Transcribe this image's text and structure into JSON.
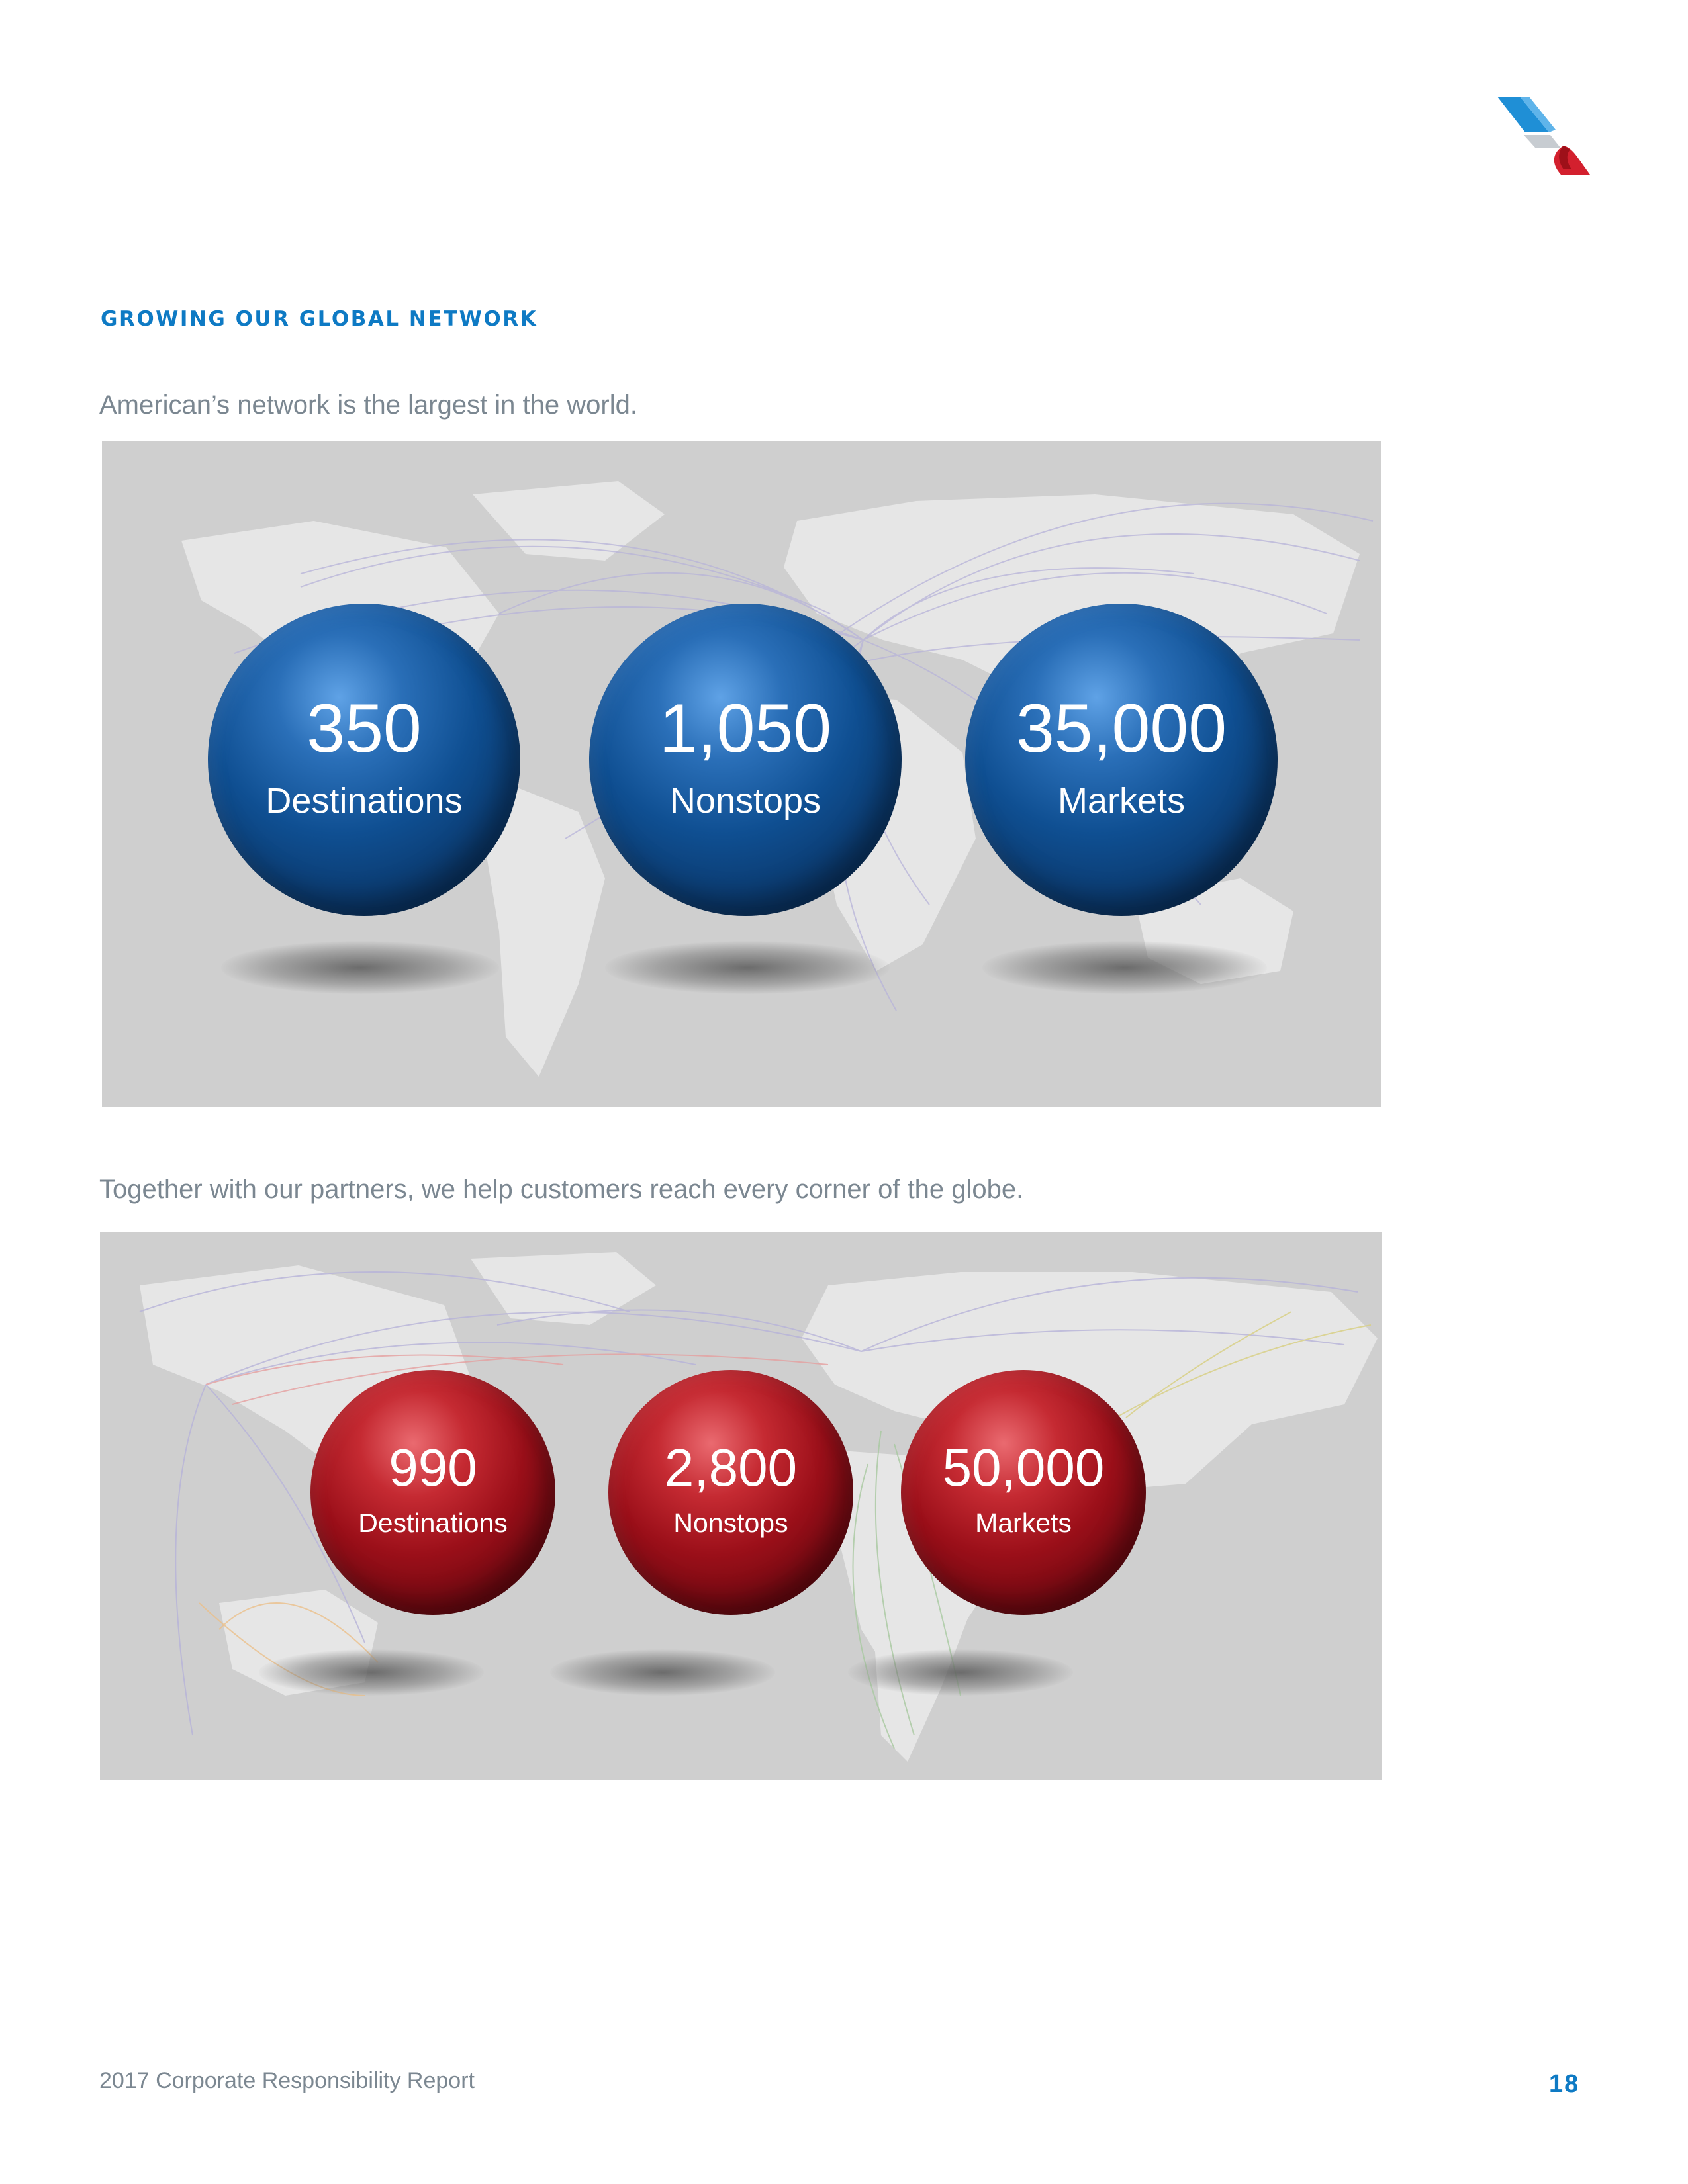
{
  "brand": {
    "logo_icon": "american-airlines-flight-symbol-icon",
    "colors": {
      "blue": "#0e7ac4",
      "red": "#c52a32",
      "silver": "#c7ccd1"
    }
  },
  "section": {
    "title": "GROWING OUR GLOBAL NETWORK"
  },
  "american_network": {
    "lead": "American’s network is the largest in the world.",
    "stats": [
      {
        "value": "350",
        "label": "Destinations"
      },
      {
        "value": "1,050",
        "label": "Nonstops"
      },
      {
        "value": "35,000",
        "label": "Markets"
      }
    ]
  },
  "partner_network": {
    "lead": "Together with our partners, we help customers reach every corner of the globe.",
    "stats": [
      {
        "value": "990",
        "label": "Destinations"
      },
      {
        "value": "2,800",
        "label": "Nonstops"
      },
      {
        "value": "50,000",
        "label": "Markets"
      }
    ]
  },
  "footer": {
    "report": "2017 Corporate Responsibility Report",
    "page": "18"
  }
}
